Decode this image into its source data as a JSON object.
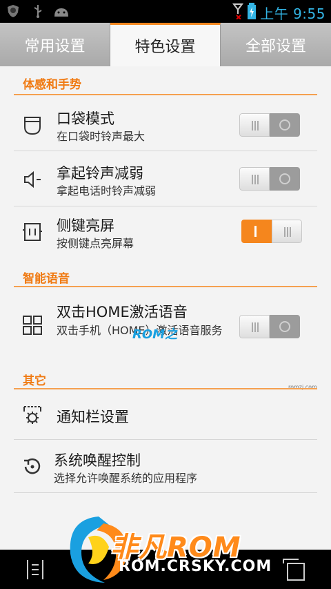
{
  "status": {
    "time": "上午 9:55",
    "icons": [
      "shield-icon",
      "usb-icon",
      "android-icon",
      "signal-icon",
      "battery-icon"
    ]
  },
  "tabs": [
    {
      "label": "常用设置",
      "active": false
    },
    {
      "label": "特色设置",
      "active": true
    },
    {
      "label": "全部设置",
      "active": false
    }
  ],
  "sections": {
    "gesture": "体感和手势",
    "voice": "智能语音",
    "other": "其它"
  },
  "rows": {
    "pocket": {
      "title": "口袋模式",
      "sub": "在口袋时铃声最大",
      "enabled": false
    },
    "pickup": {
      "title": "拿起铃声减弱",
      "sub": "拿起电话时铃声减弱",
      "enabled": false
    },
    "sidekey": {
      "title": "侧键亮屏",
      "sub": "按侧键点亮屏幕",
      "enabled": true
    },
    "home": {
      "title": "双击HOME激活语音",
      "sub": "双击手机（HOME）激活语音服务",
      "enabled": false
    },
    "notify": {
      "title": "通知栏设置"
    },
    "wakeup": {
      "title": "系统唤醒控制",
      "sub": "选择允许唤醒系统的应用程序"
    }
  },
  "watermark": {
    "brand": "非凡ROM",
    "url": "ROM.CRSKY.COM",
    "small": "ROM之",
    "tiny": "romzj.com"
  },
  "colors": {
    "accent": "#f5861d",
    "status_time": "#33b5e5"
  }
}
